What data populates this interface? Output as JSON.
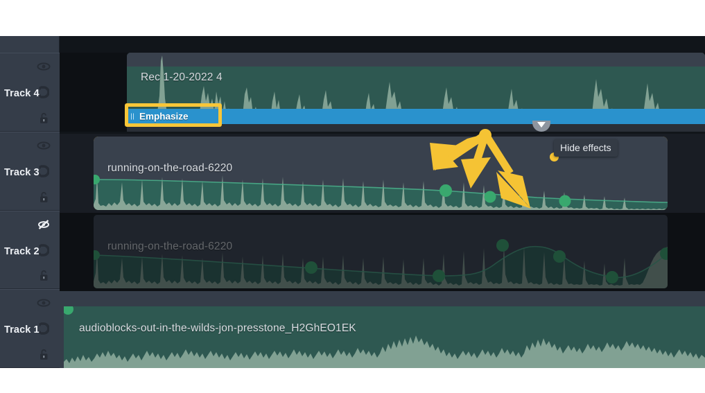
{
  "app": {
    "name": "audio-timeline-editor",
    "accent_selection": "#d9a92e",
    "accent_annotation": "#f5c334",
    "effect_bar_color": "#2a92cd",
    "clip_color": "#2e5851",
    "track_header_color": "#353d49"
  },
  "tracks": [
    {
      "id": "track5",
      "label": "",
      "partial": true,
      "icons": [
        "lock-icon"
      ]
    },
    {
      "id": "track4",
      "label": "Track 4",
      "visibility_icon": "eye-icon",
      "loop_icon": "magnet-icon",
      "lock_icon": "unlock-icon",
      "muted": false,
      "clip": {
        "name": "Rec 1-20-2022 4",
        "selected": false
      }
    },
    {
      "id": "track3",
      "label": "Track 3",
      "visibility_icon": "eye-icon",
      "loop_icon": "magnet-icon",
      "lock_icon": "unlock-icon",
      "muted": false,
      "clip": {
        "name": "running-on-the-road-6220",
        "selected": true
      }
    },
    {
      "id": "track2",
      "label": "Track 2",
      "visibility_icon": "eye-slash-icon",
      "loop_icon": "magnet-icon",
      "lock_icon": "unlock-icon",
      "muted": true,
      "clip": {
        "name": "running-on-the-road-6220",
        "selected": false
      }
    },
    {
      "id": "track1",
      "label": "Track 1",
      "visibility_icon": "eye-icon",
      "loop_icon": "magnet-icon",
      "lock_icon": "unlock-icon",
      "muted": false,
      "clip": {
        "name": "audioblocks-out-in-the-wilds-jon-presstone_H2GhEO1EK",
        "selected": false
      }
    }
  ],
  "effect_bar": {
    "label": "Emphasize",
    "highlighted": true,
    "handle_icon": "chevron-down-icon"
  },
  "tooltip": {
    "text": "Hide effects"
  },
  "annotation": {
    "arrow_count": 3,
    "targets": "volume-envelope-points"
  }
}
